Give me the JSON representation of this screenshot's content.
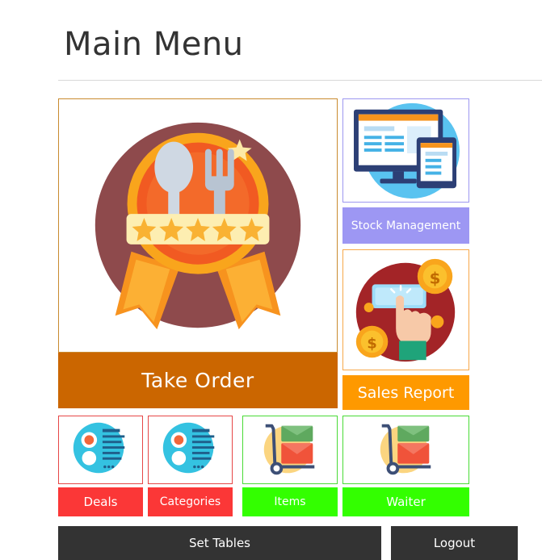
{
  "page": {
    "title": "Main Menu"
  },
  "menu": {
    "take_order": {
      "label": "Take Order",
      "icon": "award-cutlery-icon",
      "color": "#cb6600"
    },
    "stock": {
      "label": "Stock Management",
      "icon": "computer-devices-icon",
      "color": "#9d97f3"
    },
    "sales": {
      "label": "Sales Report",
      "icon": "payment-touch-icon",
      "color": "#fe9900"
    },
    "deals": {
      "label": "Deals",
      "icon": "list-document-icon",
      "color": "#fb3737"
    },
    "categories": {
      "label": "Categories",
      "icon": "list-document-icon",
      "color": "#fb3737"
    },
    "items": {
      "label": "Items",
      "icon": "hand-truck-icon",
      "color": "#33ff00"
    },
    "waiter": {
      "label": "Waiter",
      "icon": "hand-truck-icon",
      "color": "#33ff00"
    }
  },
  "footer": {
    "tables": {
      "label": "Set Tables",
      "color": "#333333"
    },
    "logout": {
      "label": "Logout",
      "color": "#333333"
    }
  }
}
